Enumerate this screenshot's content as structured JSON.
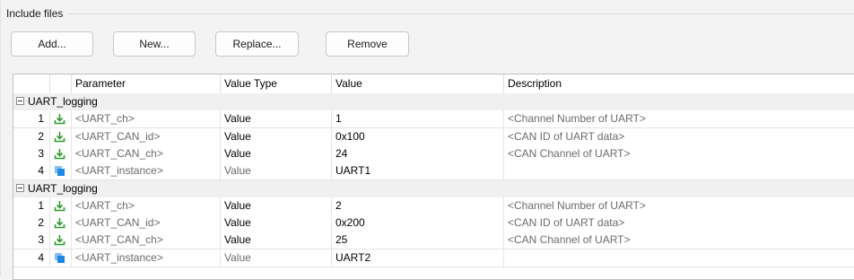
{
  "group_label": "Include files",
  "buttons": {
    "add": "Add...",
    "new": "New...",
    "replace": "Replace...",
    "remove": "Remove"
  },
  "columns": {
    "parameter": "Parameter",
    "value_type": "Value Type",
    "value": "Value",
    "description": "Description"
  },
  "groups": [
    {
      "name": "UART_logging",
      "rows": [
        {
          "index": "1",
          "icon": "download-icon",
          "parameter": "<UART_ch>",
          "value_type": "Value",
          "value": "1",
          "description": "<Channel Number of UART>"
        },
        {
          "index": "2",
          "icon": "download-icon",
          "parameter": "<UART_CAN_id>",
          "value_type": "Value",
          "value": "0x100",
          "description": "<CAN ID of UART data>"
        },
        {
          "index": "3",
          "icon": "download-icon",
          "parameter": "<UART_CAN_ch>",
          "value_type": "Value",
          "value": "24",
          "description": "<CAN Channel of UART>"
        },
        {
          "index": "4",
          "icon": "instance-icon",
          "parameter": "<UART_instance>",
          "value_type": "Value",
          "value": "UART1",
          "description": ""
        }
      ]
    },
    {
      "name": "UART_logging",
      "rows": [
        {
          "index": "1",
          "icon": "download-icon",
          "parameter": "<UART_ch>",
          "value_type": "Value",
          "value": "2",
          "description": "<Channel Number of UART>"
        },
        {
          "index": "2",
          "icon": "download-icon",
          "parameter": "<UART_CAN_id>",
          "value_type": "Value",
          "value": "0x200",
          "description": "<CAN ID of UART data>"
        },
        {
          "index": "3",
          "icon": "download-icon",
          "parameter": "<UART_CAN_ch>",
          "value_type": "Value",
          "value": "25",
          "description": "<CAN Channel of UART>"
        },
        {
          "index": "4",
          "icon": "instance-icon",
          "parameter": "<UART_instance>",
          "value_type": "Value",
          "value": "UART2",
          "description": ""
        }
      ]
    }
  ],
  "colors": {
    "download_icon": "#2e9a2e",
    "instance_icon": "#1e88e5"
  }
}
